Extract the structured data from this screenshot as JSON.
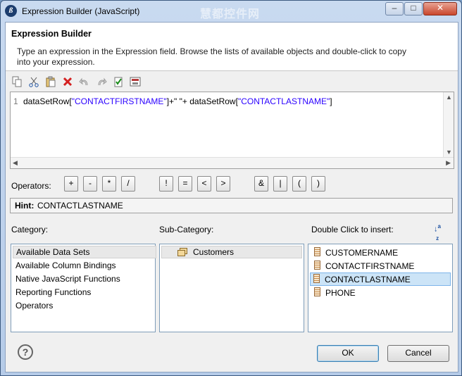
{
  "window": {
    "title": "Expression Builder (JavaScript)",
    "watermark": "慧都控件网",
    "minimize": "–",
    "maximize": "□",
    "close": "✕"
  },
  "header": {
    "title": "Expression Builder",
    "description": "Type an expression in the Expression field. Browse the lists of available objects and double-click to copy into your expression."
  },
  "toolbar": {
    "icons": [
      "copy-icon",
      "cut-icon",
      "paste-icon",
      "delete-icon",
      "undo-icon",
      "redo-icon",
      "validate-icon",
      "calculator-icon"
    ]
  },
  "editor": {
    "line_number": "1",
    "code_prefix": "dataSetRow[",
    "code_str1": "\"CONTACTFIRSTNAME\"",
    "code_mid": "]+\" \"+ dataSetRow[",
    "code_str2": "\"CONTACTLASTNAME\"",
    "code_suffix": "]"
  },
  "operators": {
    "label": "Operators:",
    "buttons": [
      "+",
      "-",
      "*",
      "/",
      "!",
      "=",
      "<",
      ">",
      "&",
      "|",
      "(",
      ")"
    ]
  },
  "hint": {
    "label": "Hint:",
    "value": "CONTACTLASTNAME"
  },
  "category": {
    "label": "Category:",
    "items": [
      "Available Data Sets",
      "Available Column Bindings",
      "Native JavaScript Functions",
      "Reporting Functions",
      "Operators"
    ],
    "selected": "Available Data Sets"
  },
  "subcategory": {
    "label": "Sub-Category:",
    "items": [
      "Customers"
    ]
  },
  "insert": {
    "label": "Double Click to insert:",
    "items": [
      "CUSTOMERNAME",
      "CONTACTFIRSTNAME",
      "CONTACTLASTNAME",
      "PHONE"
    ],
    "highlighted": "CONTACTLASTNAME"
  },
  "buttons": {
    "ok": "OK",
    "cancel": "Cancel",
    "help": "?"
  }
}
